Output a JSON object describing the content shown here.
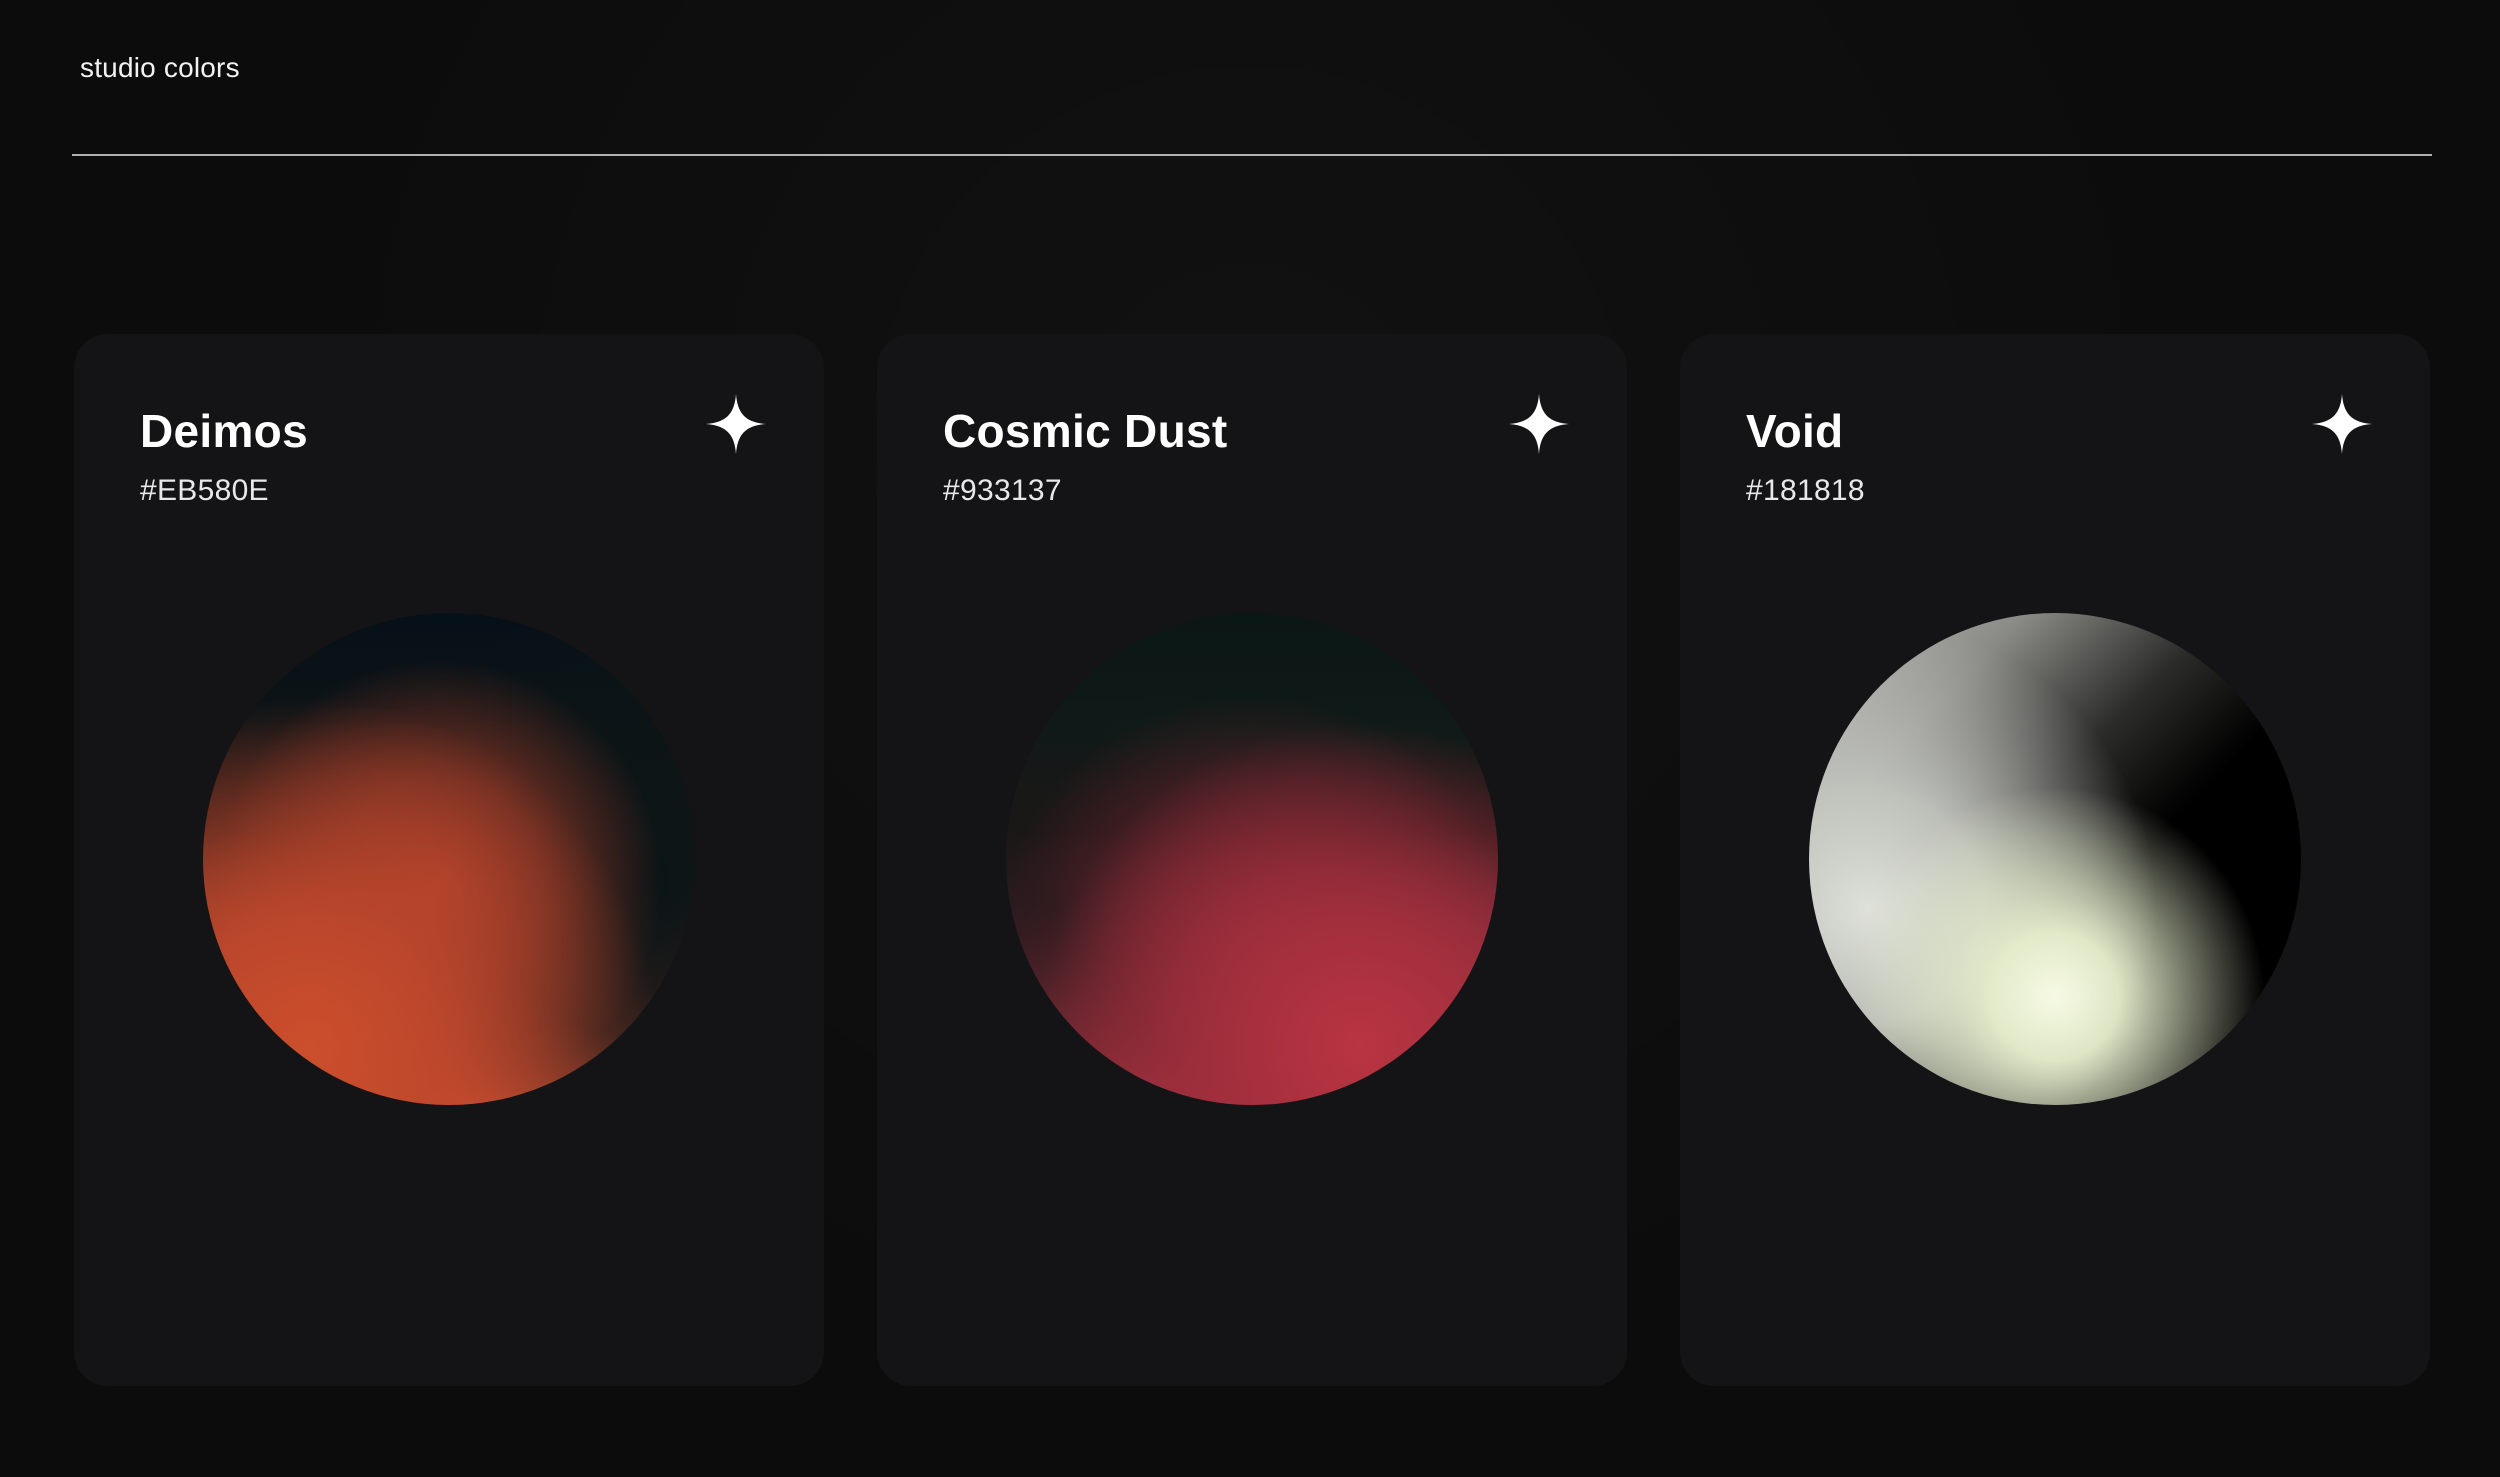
{
  "header": {
    "title": "studio colors"
  },
  "cards": [
    {
      "name": "Deimos",
      "hex": "#EB580E",
      "icon": "sparkle-icon",
      "orb_colors": [
        "#061018",
        "#A8422C",
        "#C24E32"
      ]
    },
    {
      "name": "Cosmic Dust",
      "hex": "#933137",
      "icon": "sparkle-icon",
      "orb_colors": [
        "#0B1715",
        "#5E2632",
        "#B23443"
      ]
    },
    {
      "name": "Void",
      "hex": "#181818",
      "icon": "sparkle-icon",
      "orb_colors": [
        "#000000",
        "#BDBDBB",
        "#F6FAE4"
      ]
    }
  ],
  "colors": {
    "background": "#0C0C0C",
    "card": "#141416",
    "divider": "#CFCFCF",
    "text": "#FFFFFF"
  }
}
